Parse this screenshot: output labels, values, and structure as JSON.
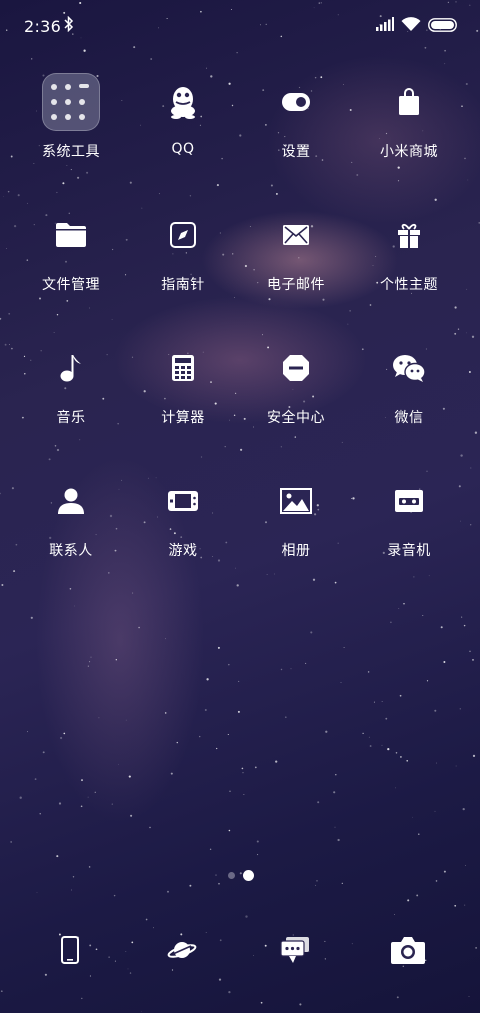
{
  "status_bar": {
    "time": "2:36",
    "bluetooth_icon": "bluetooth-icon",
    "signal_icon": "cellular-signal-icon",
    "wifi_icon": "wifi-icon",
    "battery_icon": "battery-icon"
  },
  "apps": [
    {
      "label": "系统工具",
      "icon": "folder-icon"
    },
    {
      "label": "QQ",
      "icon": "qq-penguin-icon"
    },
    {
      "label": "设置",
      "icon": "toggle-icon"
    },
    {
      "label": "小米商城",
      "icon": "shopping-bag-icon"
    },
    {
      "label": "文件管理",
      "icon": "folder-file-icon"
    },
    {
      "label": "指南针",
      "icon": "compass-icon"
    },
    {
      "label": "电子邮件",
      "icon": "envelope-icon"
    },
    {
      "label": "个性主题",
      "icon": "gift-icon"
    },
    {
      "label": "音乐",
      "icon": "music-note-icon"
    },
    {
      "label": "计算器",
      "icon": "calculator-icon"
    },
    {
      "label": "安全中心",
      "icon": "shield-minus-icon"
    },
    {
      "label": "微信",
      "icon": "wechat-icon"
    },
    {
      "label": "联系人",
      "icon": "person-icon"
    },
    {
      "label": "游戏",
      "icon": "gamepad-icon"
    },
    {
      "label": "相册",
      "icon": "image-icon"
    },
    {
      "label": "录音机",
      "icon": "recorder-icon"
    }
  ],
  "page_indicator": {
    "pages": 2,
    "current": 2
  },
  "dock": [
    {
      "icon": "phone-icon"
    },
    {
      "icon": "browser-planet-icon"
    },
    {
      "icon": "messages-icon"
    },
    {
      "icon": "camera-icon"
    }
  ],
  "colors": {
    "accent": "#ffffff"
  }
}
